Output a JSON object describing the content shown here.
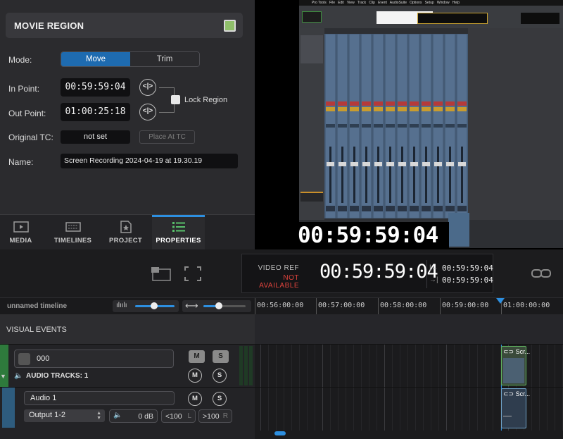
{
  "properties": {
    "section_title": "MOVIE REGION",
    "mode_label": "Mode:",
    "mode_options": [
      "Move",
      "Trim"
    ],
    "in_point_label": "In Point:",
    "in_point_value": "00:59:59:04",
    "out_point_label": "Out Point:",
    "out_point_value": "01:00:25:18",
    "lock_region_label": "Lock Region",
    "original_tc_label": "Original TC:",
    "original_tc_value": "not set",
    "place_at_tc_label": "Place At TC",
    "name_label": "Name:",
    "name_value": "Screen Recording 2024-04-19 at 19.30.19",
    "swatch_color": "#8fbf6a"
  },
  "tabs": [
    {
      "label": "MEDIA",
      "icon": "media-icon"
    },
    {
      "label": "TIMELINES",
      "icon": "timelines-icon"
    },
    {
      "label": "PROJECT",
      "icon": "project-icon"
    },
    {
      "label": "PROPERTIES",
      "icon": "properties-icon",
      "active": true
    }
  ],
  "video": {
    "burn_in_tc": "00:59:59:04",
    "app_title": "Pro Tools",
    "app_menu": [
      "Pro Tools",
      "File",
      "Edit",
      "View",
      "Track",
      "Clip",
      "Event",
      "AudioSuite",
      "Options",
      "Setup",
      "Window",
      "Help"
    ]
  },
  "transport": {
    "video_ref_label": "VIDEO REF",
    "video_ref_status": "NOT AVAILABLE",
    "main_tc": "00:59:59:04",
    "in_tc": "00:59:59:04",
    "out_tc": "00:59:59:04"
  },
  "timeline": {
    "name": "unnamed timeline",
    "ruler": [
      "00:56:00:00",
      "00:57:00:00",
      "00:58:00:00",
      "00:59:00:00",
      "01:00:00:00"
    ]
  },
  "tracks": {
    "visual_events_label": "VISUAL EVENTS",
    "video_track_name": "000",
    "audio_tracks_label": "AUDIO TRACKS: 1",
    "audio_track_name": "Audio 1",
    "output": "Output 1-2",
    "volume": "0 dB",
    "pan_left": "<100",
    "pan_left_suffix": "L",
    "pan_right": ">100",
    "pan_right_suffix": "R",
    "m_label": "M",
    "s_label": "S",
    "clip_label": "Scr..."
  }
}
